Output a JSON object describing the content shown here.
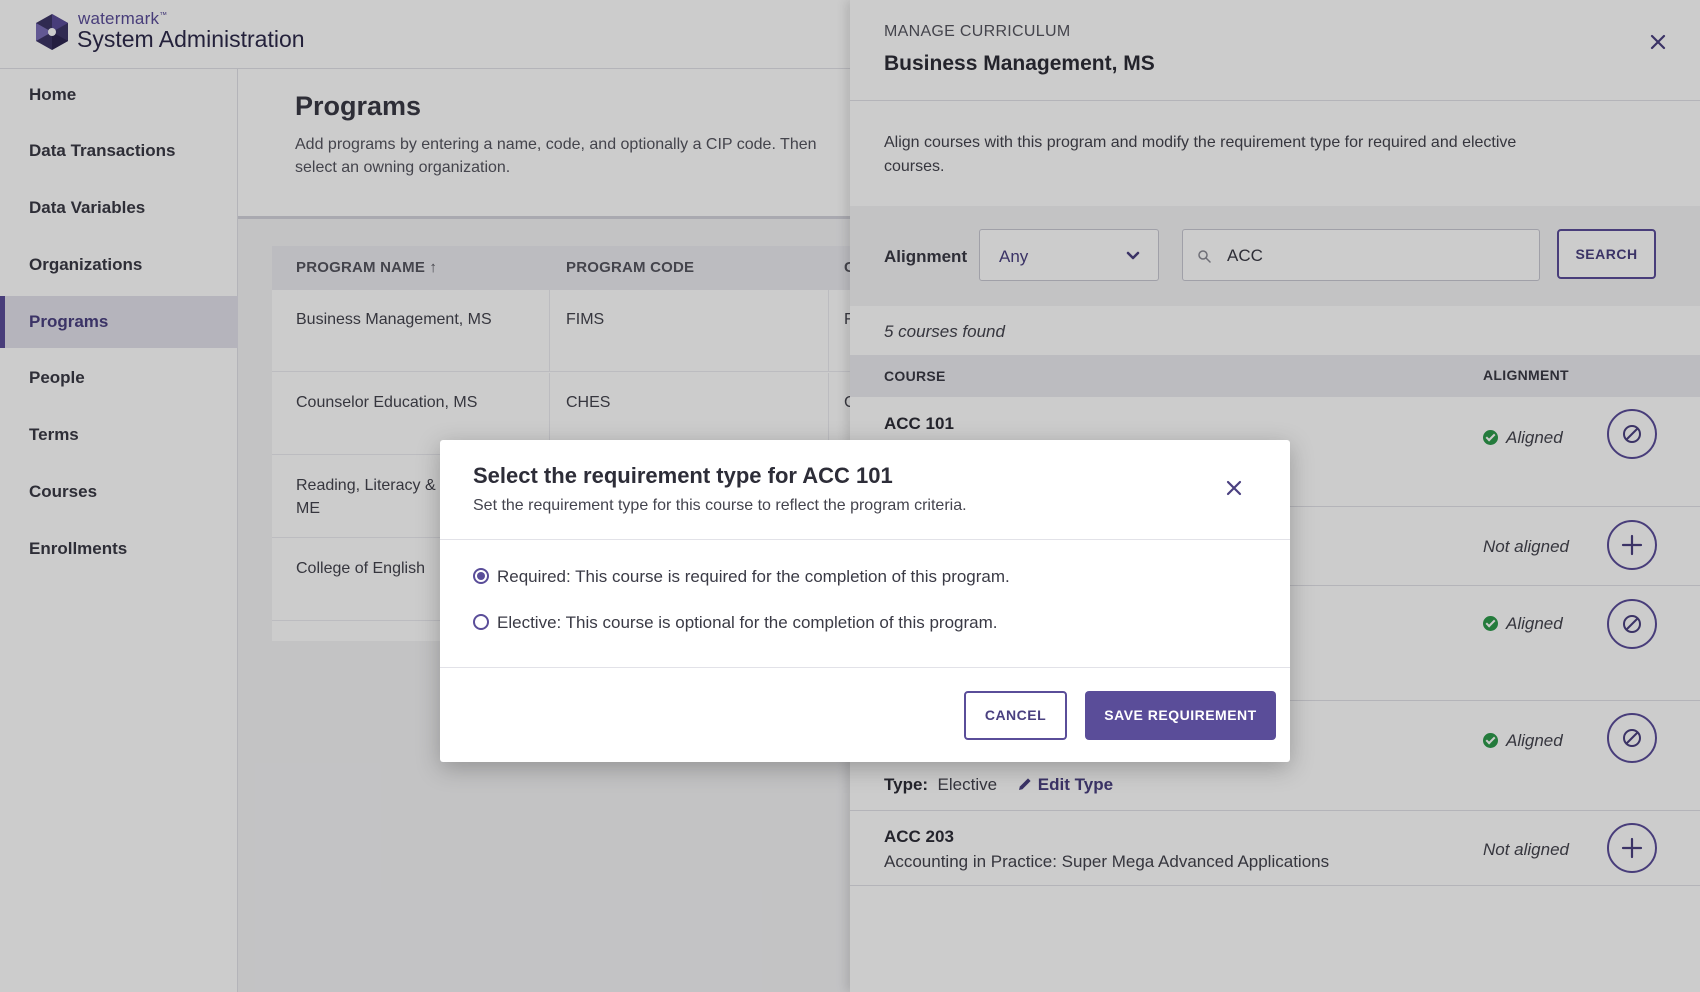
{
  "app": {
    "brand_small": "watermark",
    "brand_tm": "™",
    "brand_title": "System Administration",
    "colors": {
      "accent": "#5a4d99",
      "success": "#2e9a4b"
    }
  },
  "sidebar": {
    "items": [
      {
        "label": "Home"
      },
      {
        "label": "Data Transactions"
      },
      {
        "label": "Data Variables"
      },
      {
        "label": "Organizations"
      },
      {
        "label": "Programs",
        "active": true
      },
      {
        "label": "People"
      },
      {
        "label": "Terms"
      },
      {
        "label": "Courses"
      },
      {
        "label": "Enrollments"
      }
    ]
  },
  "programs": {
    "title": "Programs",
    "description": "Add programs by entering a name, code, and optionally a CIP code. Then select an owning organization.",
    "columns": [
      "PROGRAM NAME ↑",
      "PROGRAM CODE",
      "C"
    ],
    "rows": [
      {
        "name": "Business Management, MS",
        "code": "FIMS",
        "third": "F"
      },
      {
        "name": "Counselor Education, MS",
        "code": "CHES",
        "third": "C"
      },
      {
        "name": "Reading, Literacy &",
        "name2": "ME",
        "code": "",
        "third": ""
      },
      {
        "name": "College of English",
        "code": "",
        "third": ""
      }
    ]
  },
  "panel": {
    "kicker": "MANAGE CURRICULUM",
    "title": "Business Management, MS",
    "description": "Align courses with this program and modify the requirement type for required and elective courses.",
    "filter_label": "Alignment",
    "alignment_value": "Any",
    "search_value": "ACC",
    "search_button": "SEARCH",
    "found_text": "5 courses found",
    "col_course": "COURSE",
    "col_alignment": "ALIGNMENT",
    "courses": [
      {
        "code": "ACC 101",
        "name": "",
        "status": "Aligned"
      },
      {
        "code": "",
        "name": "",
        "status": "Not aligned"
      },
      {
        "code": "",
        "name": "",
        "status": "Aligned"
      },
      {
        "code": "",
        "name": "",
        "status": "Aligned",
        "type_label": "Type:",
        "type_value": "Elective",
        "edit_label": "Edit Type"
      },
      {
        "code": "ACC 203",
        "name": "Accounting in Practice: Super Mega Advanced Applications",
        "status": "Not aligned"
      }
    ]
  },
  "modal": {
    "title": "Select the requirement type for ACC 101",
    "subtitle": "Set the requirement type for this course to reflect the program criteria.",
    "options": [
      {
        "label": "Required: This course is required for the completion of this program.",
        "selected": true
      },
      {
        "label": "Elective: This course is optional for the completion of this program.",
        "selected": false
      }
    ],
    "cancel_label": "CANCEL",
    "save_label": "SAVE REQUIREMENT"
  }
}
